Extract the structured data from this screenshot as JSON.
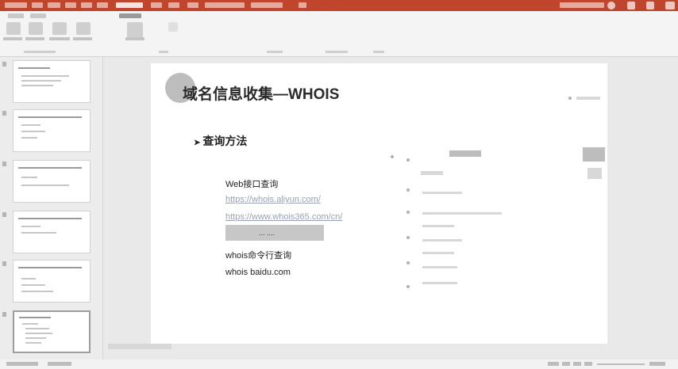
{
  "slide": {
    "title": "域名信息收集—WHOIS",
    "bullet": "查询方法",
    "bullet_marker": "➤",
    "items": [
      {
        "text": "Web接口查询",
        "style": "normal"
      },
      {
        "text": "https://whois.aliyun.com/",
        "style": "link"
      },
      {
        "text": "https://www.whois365.com/cn/",
        "style": "link"
      },
      {
        "text": "whois命令行查询",
        "style": "normal"
      },
      {
        "text": "whois baidu.com",
        "style": "normal"
      }
    ],
    "highlight_text": "...          ...."
  },
  "sidebar": {
    "slide_numbers": [
      "1",
      "2",
      "3",
      "4",
      "5",
      "6"
    ],
    "selected_index": 5
  },
  "colors": {
    "titlebar": "#c0452d",
    "ribbon": "#f4f4f4",
    "slide_bg": "#ffffff",
    "link": "#9aa0b8"
  },
  "icons": [
    "minimize-icon",
    "maximize-icon",
    "close-icon"
  ]
}
